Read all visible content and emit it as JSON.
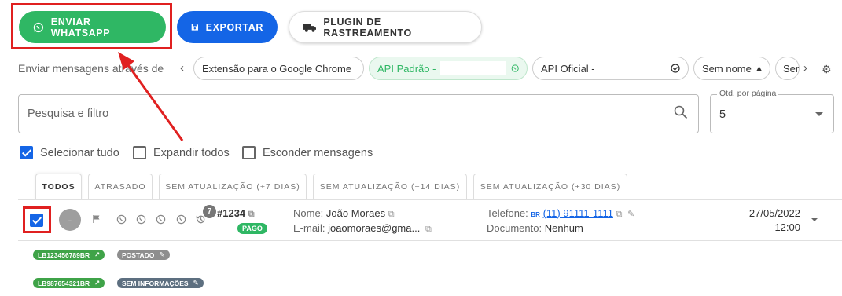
{
  "toolbar": {
    "whatsapp_label": "ENVIAR WHATSAPP",
    "export_label": "EXPORTAR",
    "plugin_label": "PLUGIN DE RASTREAMENTO"
  },
  "send_via": {
    "label": "Enviar mensagens através de",
    "chips": [
      {
        "label": "Extensão para o Google Chrome"
      },
      {
        "label": "API Padrão -"
      },
      {
        "label": "API Oficial -"
      },
      {
        "label": "Sem nome"
      },
      {
        "label": "Ser"
      }
    ]
  },
  "search": {
    "placeholder": "Pesquisa e filtro"
  },
  "per_page": {
    "legend": "Qtd. por página",
    "value": "5"
  },
  "options": {
    "select_all": "Selecionar tudo",
    "expand_all": "Expandir todos",
    "hide_messages": "Esconder mensagens"
  },
  "tabs": [
    {
      "label": "TODOS"
    },
    {
      "label": "ATRASADO"
    },
    {
      "label": "SEM ATUALIZAÇÃO (+7 DIAS)"
    },
    {
      "label": "SEM ATUALIZAÇÃO (+14 DIAS)"
    },
    {
      "label": "SEM ATUALIZAÇÃO (+30 DIAS)"
    }
  ],
  "order": {
    "avatar": "-",
    "message_count": "7",
    "number": "#1234",
    "status": "PAGO",
    "name_label": "Nome:",
    "name": "João Moraes",
    "email_label": "E-mail:",
    "email": "joaomoraes@gma...",
    "phone_label": "Telefone:",
    "phone_country": "BR",
    "phone": "(11) 91111-1111",
    "doc_label": "Documento:",
    "doc": "Nenhum",
    "date": "27/05/2022",
    "time": "12:00"
  },
  "tracking": [
    {
      "code": "LB123456789BR",
      "status": "POSTADO"
    },
    {
      "code": "LB987654321BR",
      "status": "SEM INFORMAÇÕES"
    }
  ],
  "colors": {
    "whatsapp_green": "#2fb764",
    "primary_blue": "#1465e6",
    "annotation_red": "#e02020"
  }
}
